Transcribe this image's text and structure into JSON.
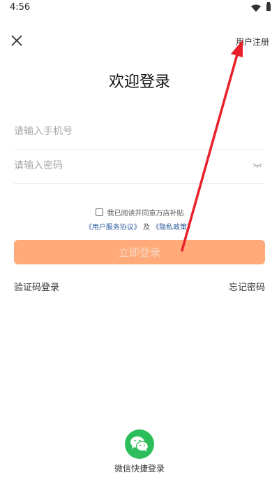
{
  "status_bar": {
    "time": "4:56"
  },
  "header": {
    "register_label": "用户注册"
  },
  "title": "欢迎登录",
  "form": {
    "phone_placeholder": "请输入手机号",
    "password_placeholder": "请输入密码"
  },
  "agreement": {
    "text": "我已阅读并同意万店补贴",
    "user_agreement": "《用户服务协议》",
    "and": "及",
    "privacy_policy": "《隐私政策》"
  },
  "buttons": {
    "login": "立即登录",
    "code_login": "验证码登录",
    "forgot_password": "忘记密码",
    "wechat_login": "微信快捷登录"
  },
  "icons": {
    "close": "close-icon",
    "eye": "eye-closed-icon",
    "wechat": "wechat-icon",
    "annotation": "red-arrow-annotation"
  },
  "colors": {
    "login_button": "#ffaa78",
    "link": "#2f5d9e",
    "wechat": "#2bbe5a",
    "annotation_arrow": "#e8202a"
  }
}
